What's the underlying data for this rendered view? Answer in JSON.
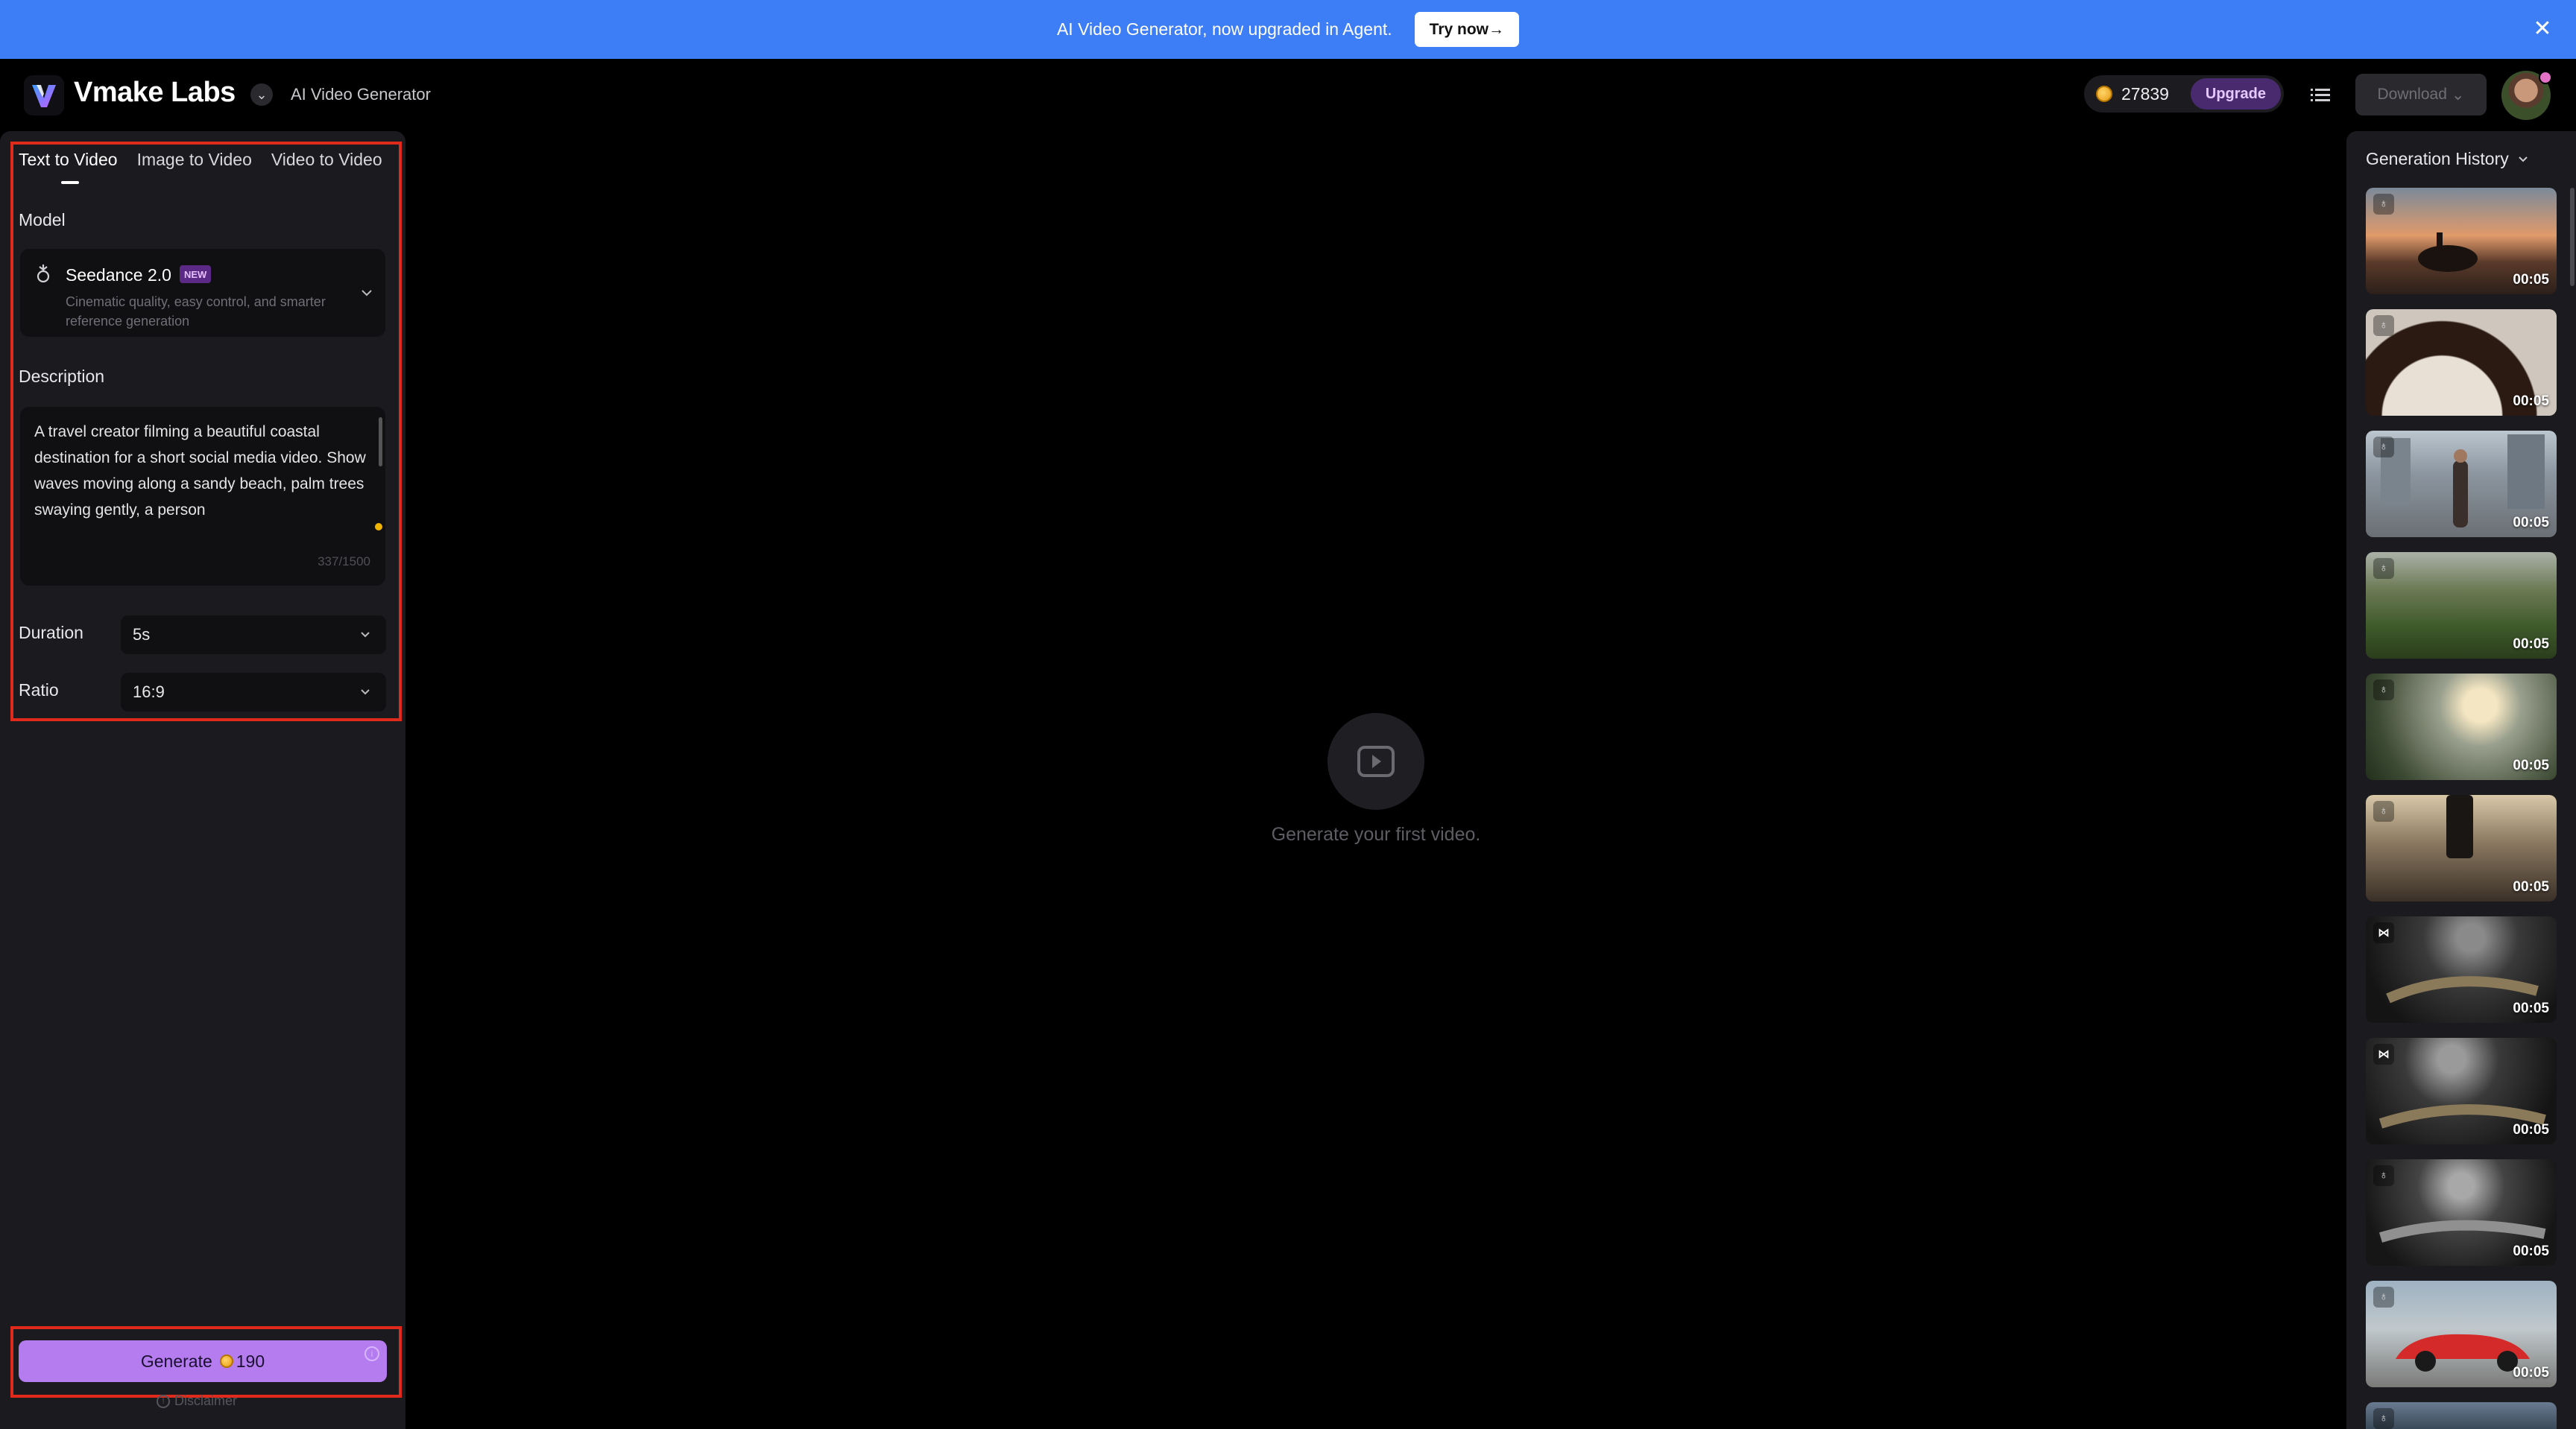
{
  "banner": {
    "text": "AI Video Generator, now upgraded in Agent.",
    "cta": "Try now→"
  },
  "header": {
    "brand": "Vmake Labs",
    "subtitle": "AI Video Generator",
    "credits": "27839",
    "upgrade": "Upgrade",
    "download": "Download"
  },
  "left": {
    "tabs": [
      "Text to Video",
      "Image to Video",
      "Video to Video"
    ],
    "active_tab": "Text to Video",
    "model_label": "Model",
    "model": {
      "name": "Seedance 2.0",
      "badge": "NEW",
      "description": "Cinematic quality, easy control, and smarter reference generation"
    },
    "description_label": "Description",
    "description_text": "A travel creator filming a beautiful coastal destination for a short social media video. Show waves moving along a sandy beach, palm trees swaying gently, a person",
    "char_count": "337/1500",
    "duration_label": "Duration",
    "duration_value": "5s",
    "ratio_label": "Ratio",
    "ratio_value": "16:9",
    "generate_label": "Generate",
    "generate_cost": "190",
    "disclaimer": "Disclaimer"
  },
  "center": {
    "empty_text": "Generate your first video."
  },
  "history": {
    "title": "Generation History",
    "items": [
      {
        "duration": "00:05",
        "icon": "seedance-icon"
      },
      {
        "duration": "00:05",
        "icon": "seedance-icon"
      },
      {
        "duration": "00:05",
        "icon": "seedance-icon"
      },
      {
        "duration": "00:05",
        "icon": "seedance-icon"
      },
      {
        "duration": "00:05",
        "icon": "seedance-icon"
      },
      {
        "duration": "00:05",
        "icon": "seedance-icon"
      },
      {
        "duration": "00:05",
        "icon": "meta-logo-icon"
      },
      {
        "duration": "00:05",
        "icon": "meta-logo-icon"
      },
      {
        "duration": "00:05",
        "icon": "seedance-icon"
      },
      {
        "duration": "00:05",
        "icon": "seedance-icon"
      }
    ]
  },
  "colors": {
    "banner": "#3d7df5",
    "accent": "#b57cf0",
    "highlight": "#e02a1c",
    "panel": "#1b1b1f"
  }
}
